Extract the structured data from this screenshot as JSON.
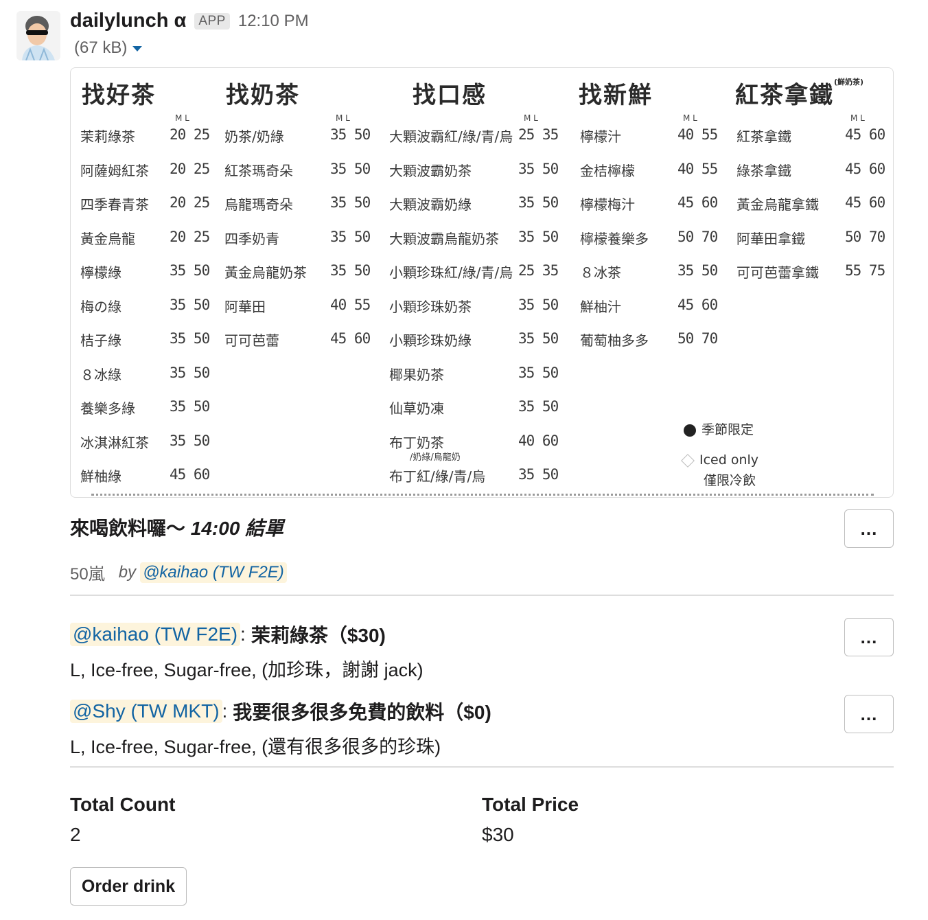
{
  "message": {
    "bot_name": "dailylunch α",
    "app_badge": "APP",
    "timestamp": "12:10 PM",
    "file_size": "(67 kB)"
  },
  "menu": {
    "columns": [
      {
        "header": "找好茶",
        "ml": "M  L",
        "rows": [
          {
            "name": "茉莉綠茶",
            "price": "20 25"
          },
          {
            "name": "阿薩姆紅茶",
            "price": "20 25"
          },
          {
            "name": "四季春青茶",
            "price": "20 25"
          },
          {
            "name": "黃金烏龍",
            "price": "20 25"
          },
          {
            "name": "檸檬綠",
            "price": "35 50"
          },
          {
            "name": "梅の綠",
            "price": "35 50"
          },
          {
            "name": "桔子綠",
            "price": "35 50"
          },
          {
            "name": "８冰綠",
            "price": "35 50"
          },
          {
            "name": "養樂多綠",
            "price": "35 50"
          },
          {
            "name": "冰淇淋紅茶",
            "price": "35 50"
          },
          {
            "name": "鮮柚綠",
            "price": "45 60"
          }
        ]
      },
      {
        "header": "找奶茶",
        "ml": "M  L",
        "rows": [
          {
            "name": "奶茶/奶綠",
            "price": "35 50"
          },
          {
            "name": "紅茶瑪奇朵",
            "price": "35 50"
          },
          {
            "name": "烏龍瑪奇朵",
            "price": "35 50"
          },
          {
            "name": "四季奶青",
            "price": "35 50"
          },
          {
            "name": "黃金烏龍奶茶",
            "price": "35 50"
          },
          {
            "name": "阿華田",
            "price": "40 55"
          },
          {
            "name": "可可芭蕾",
            "price": "45 60"
          }
        ]
      },
      {
        "header": "找口感",
        "ml": "M  L",
        "rows": [
          {
            "name": "大顆波霸紅/綠/青/烏",
            "price": "25 35"
          },
          {
            "name": "大顆波霸奶茶",
            "price": "35 50"
          },
          {
            "name": "大顆波霸奶綠",
            "price": "35 50"
          },
          {
            "name": "大顆波霸烏龍奶茶",
            "price": "35 50"
          },
          {
            "name": "小顆珍珠紅/綠/青/烏",
            "price": "25 35"
          },
          {
            "name": "小顆珍珠奶茶",
            "price": "35 50"
          },
          {
            "name": "小顆珍珠奶綠",
            "price": "35 50"
          },
          {
            "name": "椰果奶茶",
            "price": "35 50"
          },
          {
            "name": "仙草奶凍",
            "price": "35 50"
          },
          {
            "name": "布丁奶茶",
            "price": "40 60"
          },
          {
            "name": "布丁紅/綠/青/烏",
            "price": "35 50"
          }
        ],
        "pudding_note": "/奶綠/烏龍奶"
      },
      {
        "header": "找新鮮",
        "ml": "M  L",
        "rows": [
          {
            "name": "檸檬汁",
            "price": "40 55"
          },
          {
            "name": "金桔檸檬",
            "price": "40 55"
          },
          {
            "name": "檸檬梅汁",
            "price": "45 60"
          },
          {
            "name": "檸檬養樂多",
            "price": "50 70"
          },
          {
            "name": "８冰茶",
            "price": "35 50"
          },
          {
            "name": "鮮柚汁",
            "price": "45 60"
          },
          {
            "name": "葡萄柚多多",
            "price": "50 70"
          }
        ]
      },
      {
        "header": "紅茶拿鐵",
        "header_note": "(鮮奶茶)",
        "ml": "M  L",
        "rows": [
          {
            "name": "紅茶拿鐵",
            "price": "45 60"
          },
          {
            "name": "綠茶拿鐵",
            "price": "45 60"
          },
          {
            "name": "黃金烏龍拿鐵",
            "price": "45 60"
          },
          {
            "name": "阿華田拿鐵",
            "price": "50 70"
          },
          {
            "name": "可可芭蕾拿鐵",
            "price": "55 75"
          }
        ]
      }
    ],
    "legend": {
      "seasonal": "季節限定",
      "iced_only": "Iced only",
      "iced_only_zh": "僅限冷飲"
    }
  },
  "order_title": {
    "prefix": "來喝飲料囉～ ",
    "deadline": "14:00 結單"
  },
  "meta": {
    "shop": "50嵐",
    "by": "by",
    "author": "@kaihao (TW F2E)"
  },
  "orders": [
    {
      "user": "@kaihao (TW F2E)",
      "item": "茉莉綠茶（$30)",
      "options": "L, Ice-free, Sugar-free, (加珍珠，謝謝 jack)"
    },
    {
      "user": "@Shy (TW MKT)",
      "item": "我要很多很多免費的飲料（$0)",
      "options": "L, Ice-free, Sugar-free, (還有很多很多的珍珠)"
    }
  ],
  "totals": {
    "count_label": "Total Count",
    "count_value": "2",
    "price_label": "Total Price",
    "price_value": "$30"
  },
  "actions": {
    "more": "...",
    "order_button": "Order drink"
  }
}
